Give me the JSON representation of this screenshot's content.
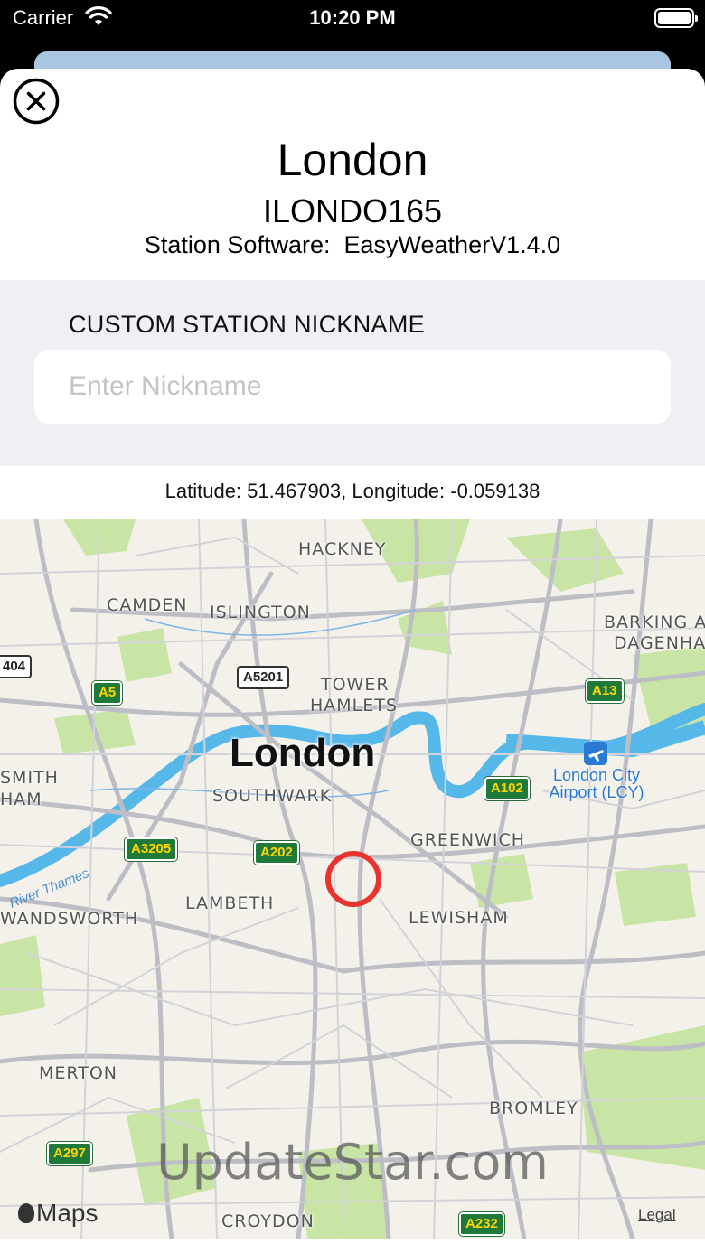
{
  "status_bar": {
    "carrier": "Carrier",
    "time": "10:20 PM"
  },
  "header": {
    "station_name": "London",
    "station_id": "ILONDO165",
    "software_label": "Station Software:",
    "software_value": "EasyWeatherV1.4.0"
  },
  "form": {
    "nickname_header": "CUSTOM STATION NICKNAME",
    "nickname_value": "",
    "nickname_placeholder": "Enter Nickname"
  },
  "location": {
    "coords_text": "Latitude: 51.467903, Longitude: -0.059138"
  },
  "map": {
    "city_label": "London",
    "area_labels": {
      "hackney": "HACKNEY",
      "camden": "CAMDEN",
      "islington": "ISLINGTON",
      "tower": "TOWER",
      "hamlets": "HAMLETS",
      "barking": "BARKING AN",
      "dagenham": "DAGENHAM",
      "smith": "SMITH",
      "ham": "HAM",
      "southwark": "SOUTHWARK",
      "greenwich": "GREENWICH",
      "lambeth": "LAMBETH",
      "wandsworth": "WANDSWORTH",
      "lewisham": "LEWISHAM",
      "merton": "MERTON",
      "bromley": "BROMLEY",
      "croydon": "CROYDON"
    },
    "airport_line1": "London City",
    "airport_line2": "Airport (LCY)",
    "river_label": "River Thames",
    "roads": {
      "a404": "404",
      "a5": "A5",
      "a5201": "A5201",
      "a13": "A13",
      "a102": "A102",
      "a3205": "A3205",
      "a202": "A202",
      "a297": "A297",
      "a232": "A232"
    },
    "maps_brand": "Maps",
    "legal": "Legal",
    "watermark": "UpdateStar.com",
    "colors": {
      "water": "#55b8e8",
      "park": "#c9e5a6",
      "road": "#bdbdc6",
      "marker": "#e8332e"
    }
  }
}
